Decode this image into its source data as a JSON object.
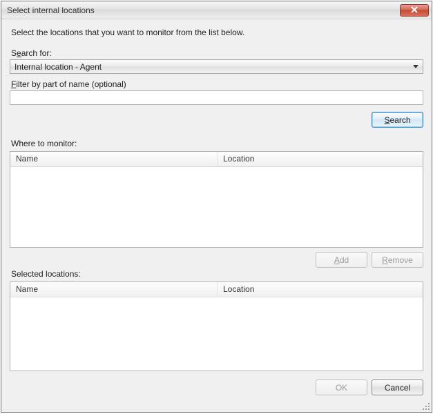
{
  "window": {
    "title": "Select internal locations"
  },
  "instruction": "Select the locations that you want to monitor from the list below.",
  "search": {
    "label_pre": "S",
    "label_u": "e",
    "label_post": "arch for:",
    "selected": "Internal location - Agent",
    "filter_label_u": "F",
    "filter_label_post": "ilter by part of name (optional)",
    "filter_value": "",
    "button_u": "S",
    "button_post": "earch"
  },
  "where": {
    "label": "Where to monitor:",
    "col_name": "Name",
    "col_location": "Location"
  },
  "actions": {
    "add_u": "A",
    "add_post": "dd",
    "remove_u": "R",
    "remove_post": "emove"
  },
  "selected": {
    "label": "Selected locations:",
    "col_name": "Name",
    "col_location": "Location"
  },
  "footer": {
    "ok": "OK",
    "cancel": "Cancel"
  }
}
